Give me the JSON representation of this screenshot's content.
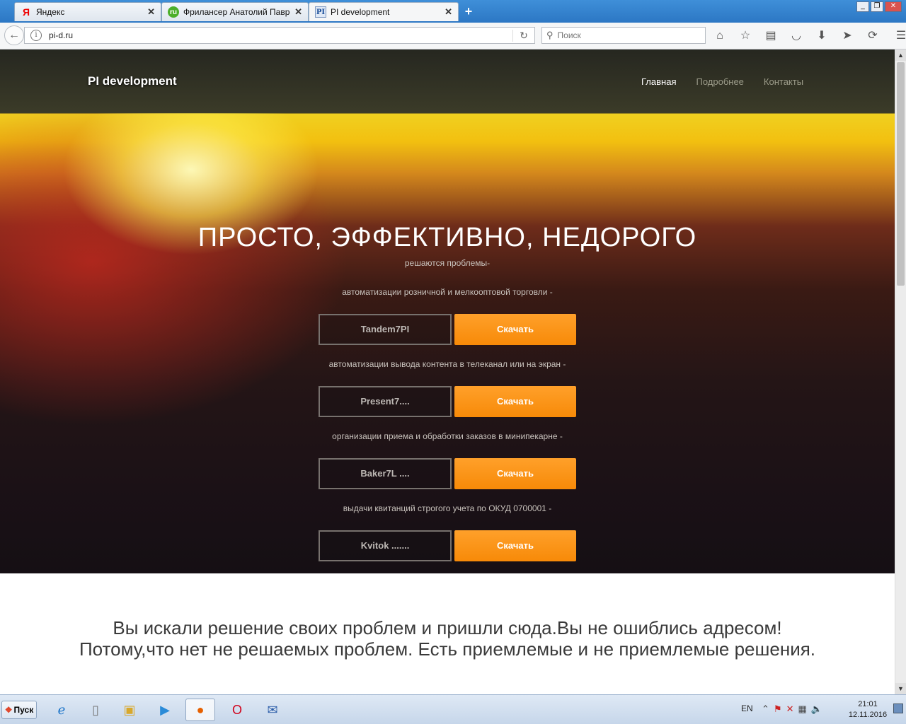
{
  "browser": {
    "tabs": [
      {
        "label": "Яндекс",
        "favicon": "Я",
        "active": false
      },
      {
        "label": "Фрилансер Анатолий Павро...",
        "favicon": "ru",
        "active": false
      },
      {
        "label": "PI development",
        "favicon": "PI",
        "active": true
      }
    ],
    "new_tab": "+",
    "url": "pi-d.ru",
    "search_placeholder": "Поиск"
  },
  "site": {
    "brand": "PI development",
    "menu": [
      {
        "label": "Главная",
        "active": true
      },
      {
        "label": "Подробнее",
        "active": false
      },
      {
        "label": "Контакты",
        "active": false
      }
    ],
    "headline": "ПРОСТО, ЭФФЕКТИВНО, НЕДОРОГО",
    "subline": "решаются проблемы-",
    "products": [
      {
        "caption": "автоматизации розничной и мелкооптовой торговли -",
        "name": "Tandem7PI",
        "button": "Скачать"
      },
      {
        "caption": "автоматизации вывода контента в телеканал или на экран -",
        "name": "Present7....",
        "button": "Скачать"
      },
      {
        "caption": "организации приема и обработки заказов в минипекарне -",
        "name": "Baker7L ....",
        "button": "Скачать"
      },
      {
        "caption": "выдачи квитанций строгого учета по ОКУД 0700001 -",
        "name": "Kvitok .......",
        "button": "Скачать"
      }
    ],
    "bottom_text": "Вы искали решение своих проблем и пришли сюда.Вы не ошиблись адресом! Потому,что нет не решаемых проблем. Есть приемлемые и не приемлемые решения.",
    "colors": {
      "accent": "#f78a08",
      "hero_dark": "#150f14"
    }
  },
  "taskbar": {
    "start_label": "Пуск",
    "lang": "EN",
    "time": "21:01",
    "date": "12.11.2016"
  }
}
